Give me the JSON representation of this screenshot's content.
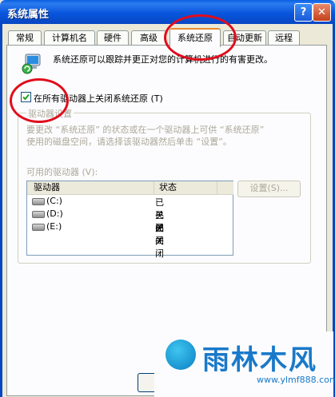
{
  "window": {
    "title": "系统属性",
    "help_label": "?",
    "close_label": "✕"
  },
  "tabs": [
    {
      "label": "常规"
    },
    {
      "label": "计算机名"
    },
    {
      "label": "硬件"
    },
    {
      "label": "高级"
    },
    {
      "label": "系统还原",
      "active": true
    },
    {
      "label": "自动更新"
    },
    {
      "label": "远程"
    }
  ],
  "restore": {
    "icon": "system-restore-icon",
    "description": "系统还原可以跟踪并更正对您的计算机进行的有害更改。",
    "turn_off_label": "在所有驱动器上关闭系统还原 (T)",
    "turn_off_checked": true
  },
  "drive_settings": {
    "group_title": "驱动器设置",
    "text_line1": "要更改 “系统还原” 的状态或在一个驱动器上可供 “系统还原”",
    "text_line2": "使用的磁盘空间，请选择该驱动器然后单击 “设置”。",
    "available_label": "可用的驱动器 (V):",
    "columns": [
      "驱动器",
      "状态"
    ],
    "drives": [
      {
        "name": "(C:)",
        "status": "已关闭"
      },
      {
        "name": "(D:)",
        "status": "已关闭"
      },
      {
        "name": "(E:)",
        "status": "已关闭"
      }
    ],
    "settings_button": "设置(S)..."
  },
  "watermark": {
    "text": "雨林木风",
    "url": "www.ylmf888.com"
  },
  "colors": {
    "titlebar": "#0a5fe0",
    "annotation": "#e00d1c",
    "brand": "#1979c9"
  }
}
